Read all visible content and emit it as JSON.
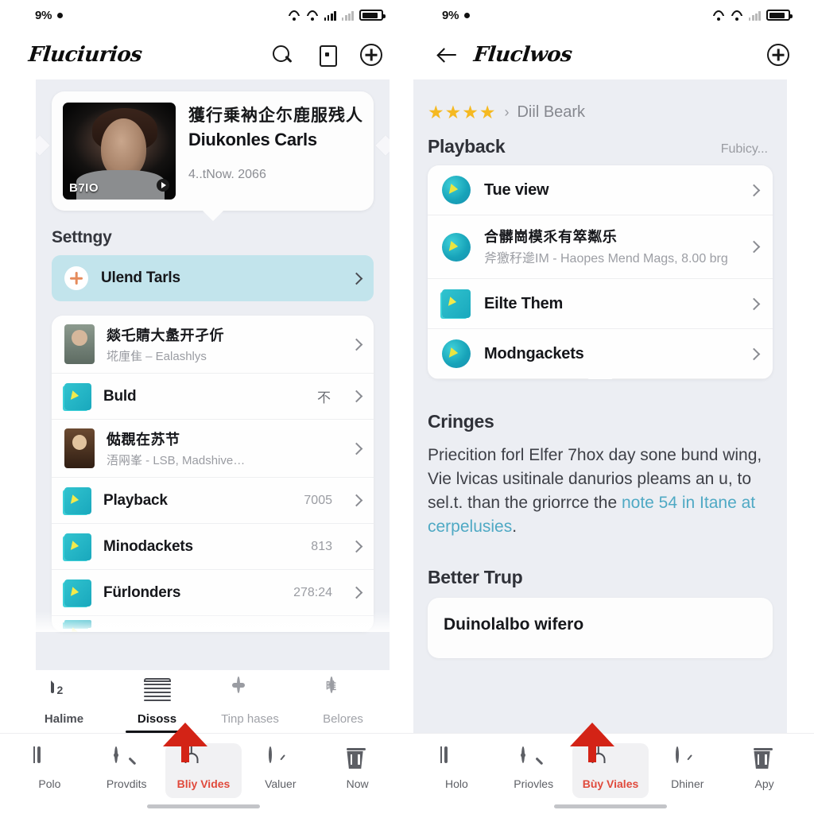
{
  "status_bar": {
    "battery_percent": "9%",
    "icons": [
      "wifi-icon",
      "wifi-icon",
      "signal-bars-icon",
      "signal-bars-dim-icon",
      "battery-icon"
    ]
  },
  "left": {
    "appbar": {
      "brand": "Fluciurios",
      "search_icon": "search-icon",
      "card_icon": "card-icon",
      "add_icon": "plus-circle-icon"
    },
    "hero": {
      "cjk_title": "獲行乗衲企尓鹿服残人",
      "title": "Diukonles Carls",
      "date": "4..tNow. 2066",
      "thumb_tag": "B7IO",
      "play_icon": "play-icon"
    },
    "section_title": "Settngy",
    "highlight_row": {
      "label": "Ulend Tarls",
      "icon": "plus-circle-orange-icon"
    },
    "list": [
      {
        "cjk": "燚乇䝼大盠开孑伒",
        "sub": "埖㢆隹 – Ealashlys",
        "meta": "",
        "icon": "portrait-thumb"
      },
      {
        "title": "Buld",
        "sub": "",
        "meta": "",
        "glyph": "不",
        "icon": "book-icon"
      },
      {
        "cjk": "㑬覠在苏节",
        "sub": "浯㒳峯 - LSB, Madshive…",
        "meta": "",
        "icon": "portrait-thumb"
      },
      {
        "title": "Playback",
        "sub": "",
        "meta": "7005",
        "icon": "book-icon"
      },
      {
        "title": "Minodackets",
        "sub": "",
        "meta": "813",
        "icon": "book-icon"
      },
      {
        "title": "Fürlonders",
        "sub": "",
        "meta": "278:24",
        "icon": "book-icon"
      }
    ],
    "segments": [
      {
        "label": "Halime",
        "icon": "document-icon",
        "state": "active"
      },
      {
        "label": "Disoss",
        "icon": "stack-icon",
        "state": "selected"
      },
      {
        "label": "Tinp hases",
        "icon": "dots-circle-icon",
        "state": "idle"
      },
      {
        "label": "Belores",
        "icon": "glyph-circle-icon",
        "state": "idle"
      }
    ],
    "bottom_nav": [
      {
        "label": "Polo",
        "icon": "book-outline-icon",
        "active": false
      },
      {
        "label": "Provdits",
        "icon": "search-icon",
        "active": false
      },
      {
        "label": "Bliy Vides",
        "icon": "lamp-icon",
        "active": true
      },
      {
        "label": "Valuer",
        "icon": "gauge-icon",
        "active": false
      },
      {
        "label": "Now",
        "icon": "trash-icon",
        "active": false
      }
    ]
  },
  "right": {
    "appbar": {
      "back_icon": "back-arrow-icon",
      "brand": "Fluclwos",
      "add_icon": "plus-circle-icon"
    },
    "breadcrumb": {
      "stars": "★★★★",
      "separator": "›",
      "label": "Diil Beark"
    },
    "section": {
      "title": "Playback",
      "right_label": "Fubicy..."
    },
    "list": [
      {
        "title": "Tue view",
        "sub": "",
        "icon": "circle-book-icon"
      },
      {
        "cjk": "合髒崗模乑有箤粼乐",
        "sub": "斧獥秄遪IM - Haopes Mend Mags, 8.00 brg",
        "icon": "circle-book-icon"
      },
      {
        "title": "Eilte Them",
        "sub": "",
        "icon": "square-book-icon"
      },
      {
        "title": "Modngackets",
        "sub": "",
        "icon": "circle-book-icon"
      }
    ],
    "paragraph": {
      "heading": "Cringes",
      "text_before": "Priecition forl Elfer 7hox day sone bund wing, Vie lvicas usitinale danurios pleams an u, to sel.t. than the griorrce the ",
      "link": "note 54 in Itane at cerpelusies",
      "text_after": "."
    },
    "bottom_section": {
      "heading": "Better Trup",
      "card_title": "Duinolalbo wifero"
    },
    "bottom_nav": [
      {
        "label": "Holo",
        "icon": "book-outline-icon",
        "active": false
      },
      {
        "label": "Priovles",
        "icon": "search-icon",
        "active": false
      },
      {
        "label": "Bùy Viales",
        "icon": "lamp-icon",
        "active": true
      },
      {
        "label": "Dhiner",
        "icon": "gauge-icon",
        "active": false
      },
      {
        "label": "Apy",
        "icon": "trash-icon",
        "active": false
      }
    ]
  },
  "colors": {
    "accent_red": "#d32316",
    "highlight_blue": "#c2e4ec",
    "link_blue": "#4fa9c4",
    "star_gold": "#f5b921",
    "panel_bg": "#eceef3"
  }
}
